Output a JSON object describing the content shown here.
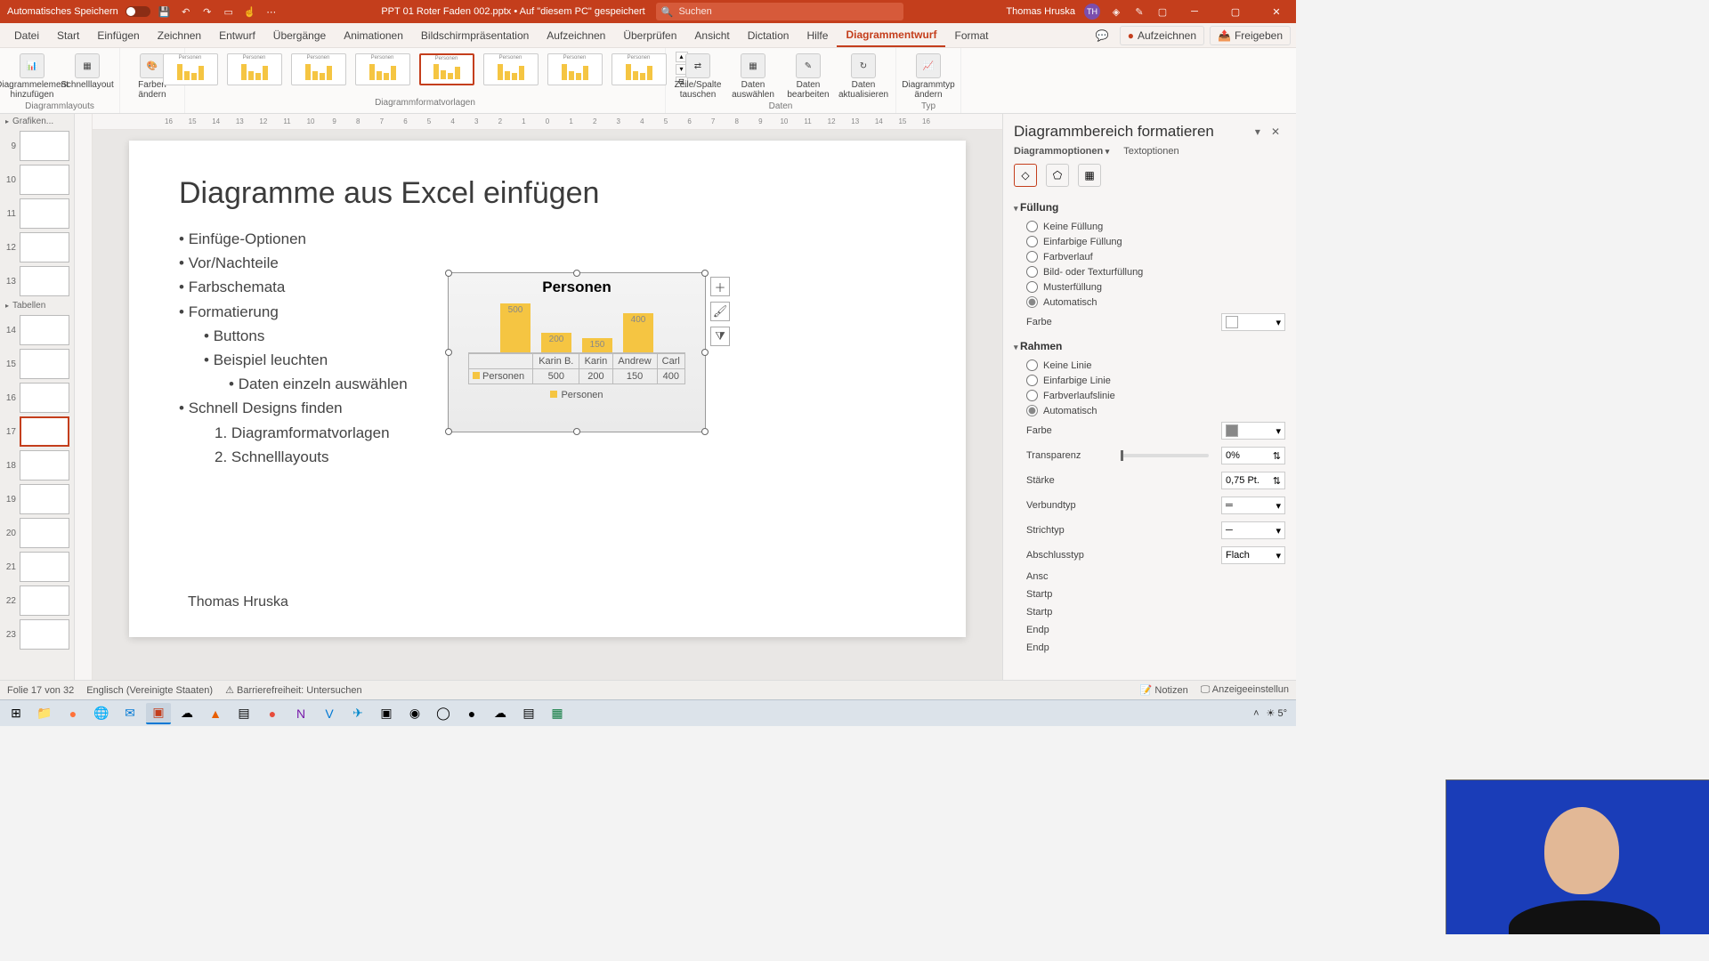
{
  "titlebar": {
    "autosave_label": "Automatisches Speichern",
    "doc_title": "PPT 01 Roter Faden 002.pptx • Auf \"diesem PC\" gespeichert",
    "search_placeholder": "Suchen",
    "user_name": "Thomas Hruska",
    "user_initials": "TH"
  },
  "menus": {
    "items": [
      "Datei",
      "Start",
      "Einfügen",
      "Zeichnen",
      "Entwurf",
      "Übergänge",
      "Animationen",
      "Bildschirmpräsentation",
      "Aufzeichnen",
      "Überprüfen",
      "Ansicht",
      "Dictation",
      "Hilfe",
      "Diagrammentwurf",
      "Format"
    ],
    "active": "Diagrammentwurf",
    "record": "Aufzeichnen",
    "share": "Freigeben"
  },
  "ribbon": {
    "g_layouts": {
      "label": "Diagrammlayouts",
      "add_element": "Diagrammelement hinzufügen",
      "quick": "Schnelllayout"
    },
    "g_colors": {
      "change": "Farben ändern"
    },
    "g_styles": {
      "label": "Diagrammformatvorlagen"
    },
    "g_data": {
      "label": "Daten",
      "swap": "Zeile/Spalte tauschen",
      "select": "Daten auswählen",
      "edit": "Daten bearbeiten",
      "refresh": "Daten aktualisieren"
    },
    "g_type": {
      "label": "Typ",
      "change": "Diagrammtyp ändern"
    }
  },
  "ruler_ticks": [
    "16",
    "15",
    "14",
    "13",
    "12",
    "11",
    "10",
    "9",
    "8",
    "7",
    "6",
    "5",
    "4",
    "3",
    "2",
    "1",
    "0",
    "1",
    "2",
    "3",
    "4",
    "5",
    "6",
    "7",
    "8",
    "9",
    "10",
    "11",
    "12",
    "13",
    "14",
    "15",
    "16"
  ],
  "thumbs": {
    "hdr1": "Grafiken...",
    "hdr2": "Tabellen",
    "nums1": [
      "9",
      "10",
      "11",
      "12",
      "13"
    ],
    "nums2": [
      "14",
      "15",
      "16",
      "17",
      "18",
      "19",
      "20",
      "21",
      "22",
      "23"
    ],
    "selected": "17"
  },
  "slide": {
    "title": "Diagramme aus Excel einfügen",
    "b1": "Einfüge-Optionen",
    "b2": "Vor/Nachteile",
    "b3": "Farbschemata",
    "b4": "Formatierung",
    "b4a": "Buttons",
    "b4b": "Beispiel leuchten",
    "b4b1": "Daten einzeln auswählen",
    "b5": "Schnell Designs finden",
    "b5o1": "Diagramformatvorlagen",
    "b5o2": "Schnelllayouts",
    "footer": "Thomas Hruska"
  },
  "chart_data": {
    "type": "bar",
    "title": "Personen",
    "categories": [
      "Karin B.",
      "Karin",
      "Andrew",
      "Carl"
    ],
    "series": [
      {
        "name": "Personen",
        "values": [
          500,
          200,
          150,
          400
        ]
      }
    ],
    "row_label": "Personen",
    "legend": "Personen",
    "ylim": [
      0,
      500
    ]
  },
  "sidepane": {
    "title": "Diagrammbereich formatieren",
    "tab_opts": "Diagrammoptionen",
    "tab_text": "Textoptionen",
    "sec_fill": "Füllung",
    "fill_none": "Keine Füllung",
    "fill_solid": "Einfarbige Füllung",
    "fill_grad": "Farbverlauf",
    "fill_pic": "Bild- oder Texturfüllung",
    "fill_pat": "Musterfüllung",
    "fill_auto": "Automatisch",
    "color": "Farbe",
    "sec_border": "Rahmen",
    "b_none": "Keine Linie",
    "b_solid": "Einfarbige Linie",
    "b_grad": "Farbverlaufslinie",
    "b_auto": "Automatisch",
    "transp": "Transparenz",
    "transp_val": "0%",
    "width": "Stärke",
    "width_val": "0,75 Pt.",
    "compound": "Verbundtyp",
    "dash": "Strichtyp",
    "cap": "Abschlusstyp",
    "cap_val": "Flach",
    "join": "Ansc",
    "start_arrow": "Startp",
    "start_size": "Startp",
    "end_arrow": "Endp",
    "end_size": "Endp"
  },
  "status": {
    "slide": "Folie 17 von 32",
    "lang": "Englisch (Vereinigte Staaten)",
    "access": "Barrierefreiheit: Untersuchen",
    "notes": "Notizen",
    "display": "Anzeigeeinstellun"
  },
  "taskbar": {
    "weather": "5°"
  }
}
